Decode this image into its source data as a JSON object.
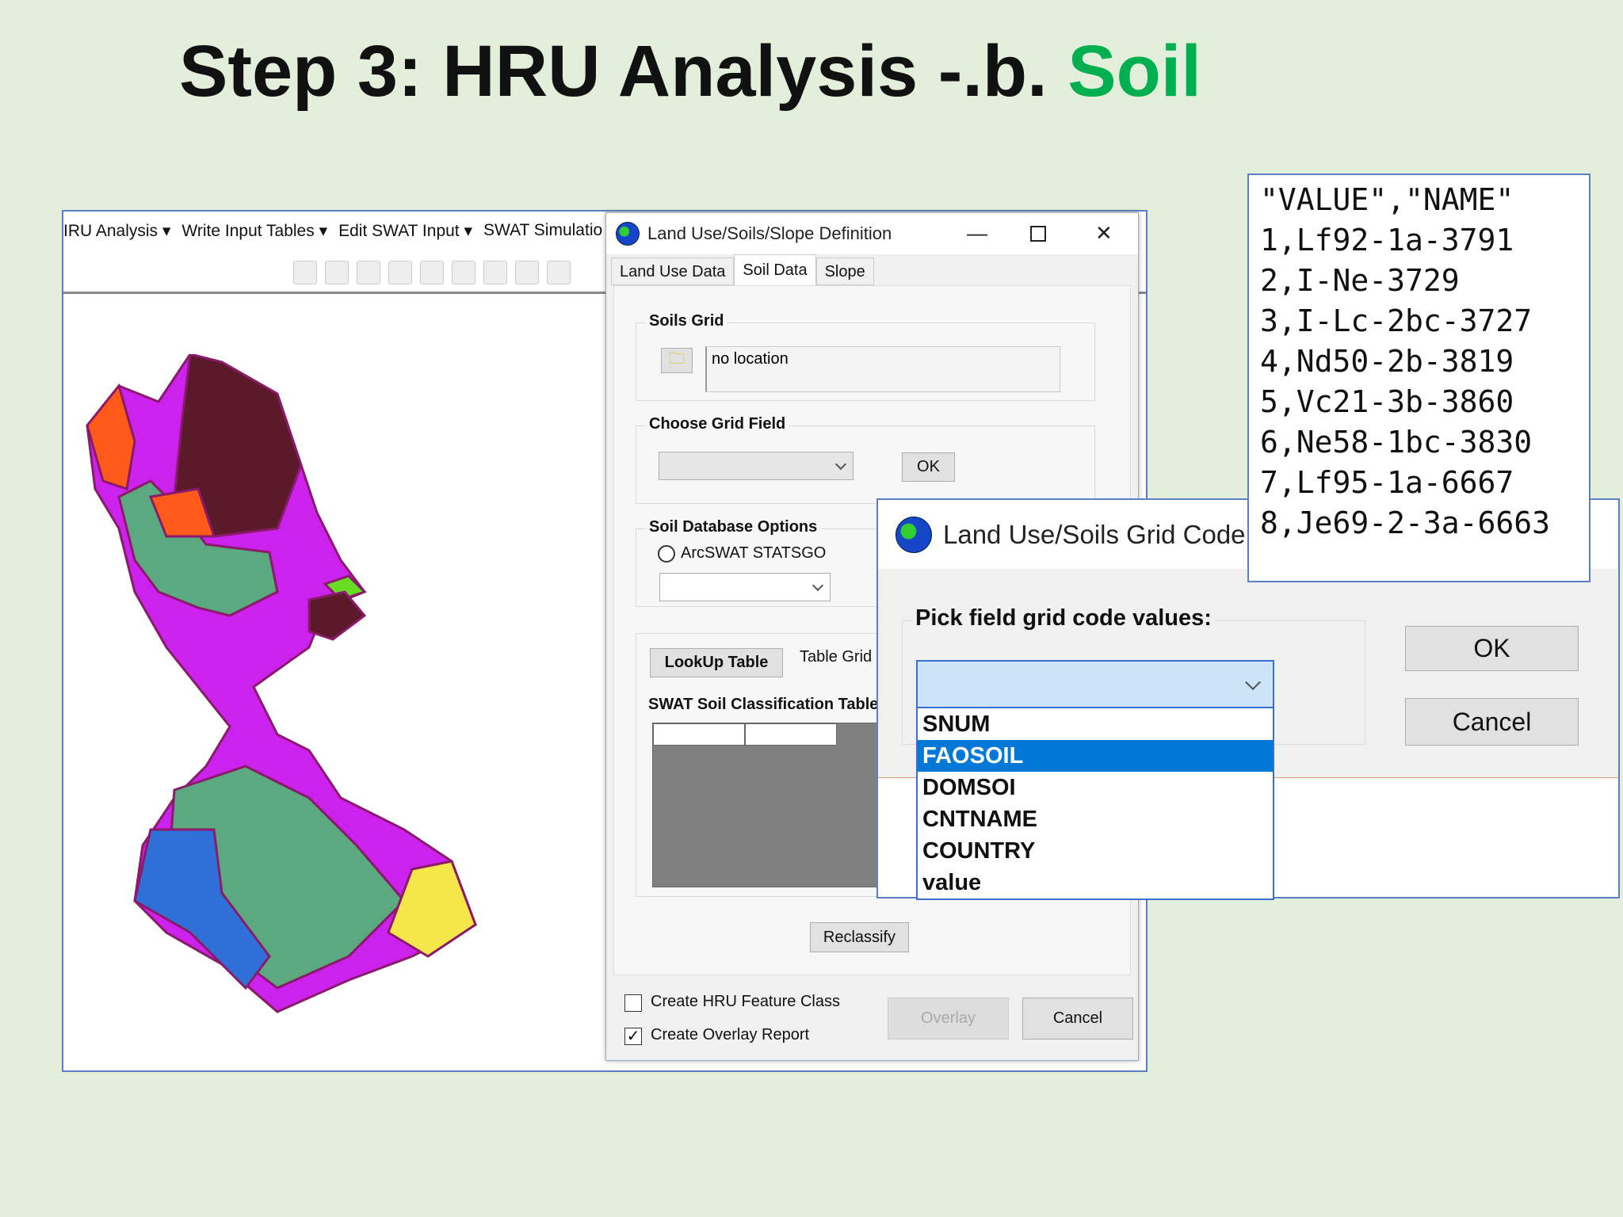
{
  "slide": {
    "title_prefix": "Step 3: HRU Analysis -.b. ",
    "title_highlight": "Soil",
    "highlight_color": "#00b050"
  },
  "main_window": {
    "menu": [
      "IRU Analysis ▾",
      "Write Input Tables ▾",
      "Edit SWAT Input ▾",
      "SWAT Simulatio"
    ],
    "toolbar_icons": [
      "zoom-in-icon",
      "zoom-out-icon",
      "pan-icon",
      "full-extent-icon",
      "fixed-zoom-icon",
      "zoom-in-fixed-icon",
      "zoom-out-fixed-icon",
      "back-icon",
      "forward-icon"
    ]
  },
  "definition_dialog": {
    "title": "Land Use/Soils/Slope Definition",
    "tabs": [
      "Land Use Data",
      "Soil Data",
      "Slope"
    ],
    "active_tab": "Soil Data",
    "soils_grid": {
      "label": "Soils Grid",
      "location": "no location"
    },
    "choose_grid_field": {
      "label": "Choose Grid Field",
      "ok": "OK"
    },
    "soil_db": {
      "label": "Soil Database Options",
      "radio": "ArcSWAT STATSGO"
    },
    "lookup_button": "LookUp Table",
    "table_grid_label": "Table Grid",
    "classification_label": "SWAT Soil Classification Table",
    "reclassify": "Reclassify",
    "create_hru": {
      "label": "Create HRU Feature Class",
      "checked": false
    },
    "create_overlay": {
      "label": "Create Overlay Report",
      "checked": true
    },
    "overlay": "Overlay",
    "cancel": "Cancel"
  },
  "grid_code_dialog": {
    "title": "Land Use/Soils Grid Code",
    "pick_label": "Pick field grid code values:",
    "ok": "OK",
    "cancel": "Cancel",
    "options": [
      "SNUM",
      "FAOSOIL",
      "DOMSOI",
      "CNTNAME",
      "COUNTRY",
      "value"
    ],
    "selected": "FAOSOIL"
  },
  "lookup_file": {
    "lines": [
      "\"VALUE\",\"NAME\"",
      "1,Lf92-1a-3791",
      "2,I-Ne-3729",
      "3,I-Lc-2bc-3727",
      "4,Nd50-2b-3819",
      "5,Vc21-3b-3860",
      "6,Ne58-1bc-3830",
      "7,Lf95-1a-6667",
      "8,Je69-2-3a-6663"
    ]
  }
}
